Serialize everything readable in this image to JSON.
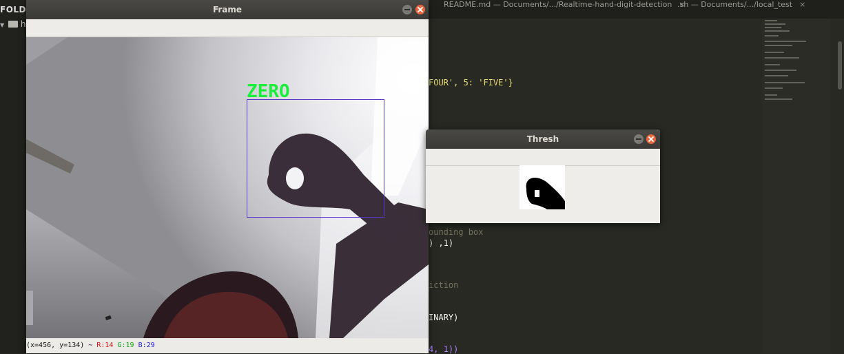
{
  "sidebar": {
    "title": "FOLD",
    "folder_label": "h"
  },
  "editor_tabs": [
    {
      "label": "README.md — Documents/.../Realtime-hand-digit-detection"
    },
    {
      "label": ".sh — Documents/.../local_test"
    }
  ],
  "tab_close_glyph": "×",
  "code_fragments": [
    {
      "text": "FOUR', 5: 'FIVE'}"
    },
    {
      "text": "ounding box"
    },
    {
      "text": ") ,1)"
    },
    {
      "text": "iction"
    },
    {
      "text": "INARY)"
    },
    {
      "text": "4, 1))"
    }
  ],
  "frame_window": {
    "title": "Frame",
    "prediction_label": "ZERO",
    "status": {
      "coords": "(x=456, y=134) ~",
      "r": "R:14",
      "g": "G:19",
      "b": "B:29"
    },
    "label_color": "#1aee3a",
    "box_color": "#5a39c8"
  },
  "thresh_window": {
    "title": "Thresh"
  },
  "colors": {
    "editor_bg": "#282923",
    "titlebar": "#3c3b37",
    "close": "#e9643a"
  }
}
